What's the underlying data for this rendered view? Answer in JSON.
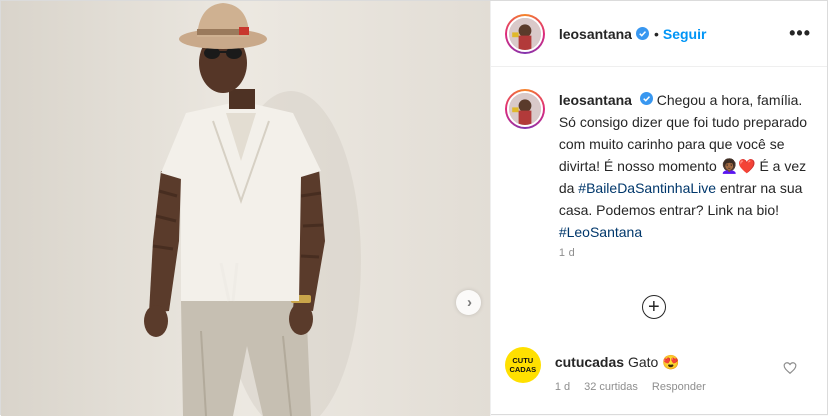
{
  "post": {
    "username": "leosantana",
    "follow_label": "Seguir",
    "dot": "•",
    "more_label": "•••"
  },
  "caption": {
    "username": "leosantana",
    "line1": "Chegou a hora, família.",
    "line2": "Só consigo dizer que foi tudo preparado com muito carinho para que você se divirta! É nosso momento",
    "emojis": "👩🏾‍🦱❤️",
    "line3_prefix": "É a vez da",
    "hashtag1": "#BaileDaSantinhaLive",
    "line3_suffix": "entrar na sua casa. Podemos entrar? Link na bio!",
    "hashtag2": "#LeoSantana",
    "time": "1 d"
  },
  "load_more_label": "+",
  "next_label": "›",
  "comment": {
    "avatar_top": "CUTU",
    "avatar_bottom": "CADAS",
    "username": "cutucadas",
    "text": "Gato",
    "emoji": "😍",
    "time": "1 d",
    "likes": "32 curtidas",
    "reply": "Responder"
  },
  "colors": {
    "accent": "#0095f6",
    "hashtag": "#00376b",
    "meta": "#8e8e8e",
    "cutucadas_yellow": "#ffe000"
  }
}
